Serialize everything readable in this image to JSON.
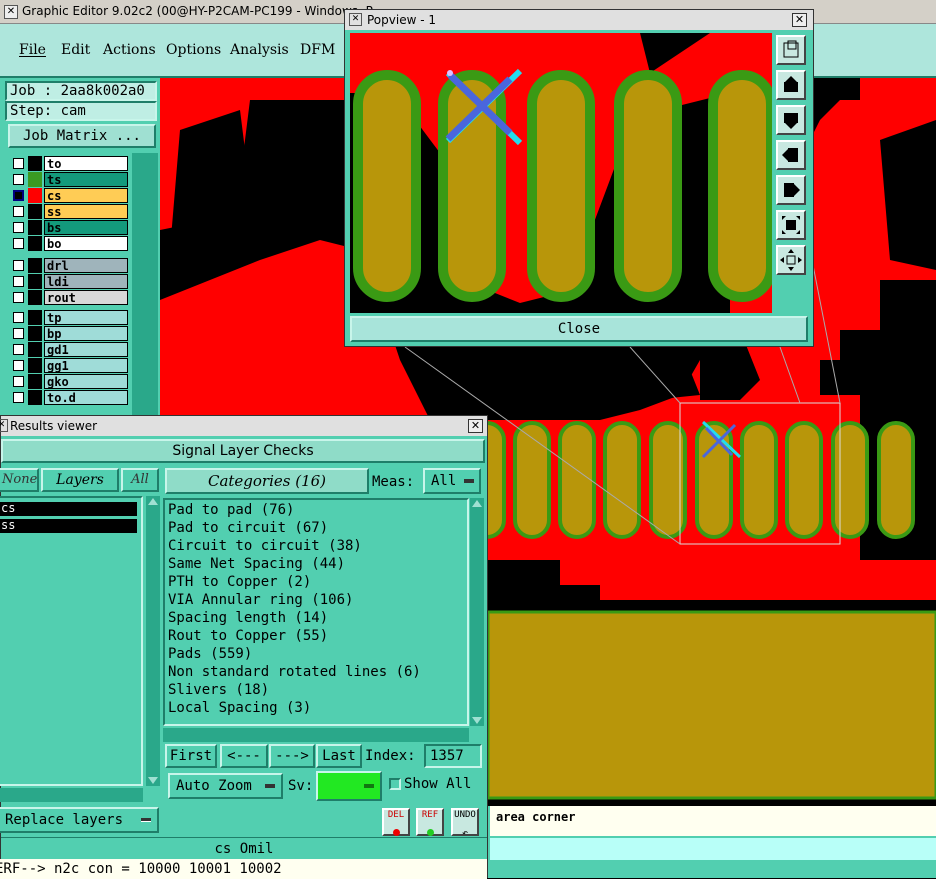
{
  "main_window": {
    "title": "Graphic Editor 9.02c2 (00@HY-P2CAM-PC199 - Windows, P",
    "menu": [
      "File",
      "Edit",
      "Actions",
      "Options",
      "Analysis",
      "DFM"
    ]
  },
  "job_panel": {
    "job": "Job : 2aa8k002a0",
    "step": "Step: cam",
    "matrix_button": "Job Matrix ...",
    "layers_group1": [
      {
        "name": "to",
        "swatch": "#000000",
        "bg": "#ffffff",
        "fg": "#000000"
      },
      {
        "name": "ts",
        "swatch": "#3a9a22",
        "bg": "#139a7c",
        "fg": "#000000"
      },
      {
        "name": "cs",
        "swatch": "#ff0000",
        "bg": "#ffcc55",
        "fg": "#000000"
      },
      {
        "name": "ss",
        "swatch": "#000000",
        "bg": "#ffcc55",
        "fg": "#000000"
      },
      {
        "name": "bs",
        "swatch": "#000000",
        "bg": "#139a7c",
        "fg": "#000000"
      },
      {
        "name": "bo",
        "swatch": "#000000",
        "bg": "#ffffff",
        "fg": "#000000"
      }
    ],
    "layers_group2": [
      {
        "name": "drl",
        "swatch": "#000000",
        "bg": "#9fb4bb",
        "fg": "#000000"
      },
      {
        "name": "ldi",
        "swatch": "#000000",
        "bg": "#9fb4bb",
        "fg": "#000000"
      },
      {
        "name": "rout",
        "swatch": "#000000",
        "bg": "#d8d8d8",
        "fg": "#000000"
      }
    ],
    "layers_group3": [
      {
        "name": "tp",
        "swatch": "#000000",
        "bg": "#9fdcd8",
        "fg": "#000000"
      },
      {
        "name": "bp",
        "swatch": "#000000",
        "bg": "#9fdcd8",
        "fg": "#000000"
      },
      {
        "name": "gd1",
        "swatch": "#000000",
        "bg": "#9fdcd8",
        "fg": "#000000"
      },
      {
        "name": "gg1",
        "swatch": "#000000",
        "bg": "#9fdcd8",
        "fg": "#000000"
      },
      {
        "name": "gko",
        "swatch": "#000000",
        "bg": "#9fdcd8",
        "fg": "#000000"
      },
      {
        "name": "to.d",
        "swatch": "#000000",
        "bg": "#9fdcd8",
        "fg": "#000000"
      }
    ]
  },
  "popview": {
    "title": "Popview - 1",
    "close_label": "Close",
    "tools": [
      "zoom-area-icon",
      "pan-up-icon",
      "pan-down-icon",
      "pan-left-icon",
      "pan-right-icon",
      "zoom-fit-icon",
      "zoom-home-icon"
    ]
  },
  "results_viewer": {
    "title": "Results viewer",
    "header": "Signal Layer Checks",
    "none_label": "None",
    "layers_label": "Layers",
    "all_label": "All",
    "layer_items": [
      "cs",
      "ss"
    ],
    "categories_label": "Categories (16)",
    "meas_label": "Meas:",
    "meas_value": "All",
    "categories": [
      "Pad to pad (76)",
      "Pad to circuit (67)",
      "Circuit to circuit (38)",
      "Same Net Spacing (44)",
      "PTH to Copper (2)",
      "VIA Annular ring (106)",
      "Spacing length (14)",
      "Rout to Copper (55)",
      "Pads (559)",
      "Non standard rotated lines (6)",
      "Slivers (18)",
      "Local Spacing (3)"
    ],
    "first_label": "First",
    "prev_label": "<---",
    "next_label": "--->",
    "last_label": "Last",
    "index_label": "Index:",
    "index_value": "1357",
    "auto_zoom_label": "Auto Zoom",
    "sv_label": "Sv:",
    "show_all_label": "Show All",
    "replace_layers_label": "Replace layers",
    "del_label": "DEL",
    "ref_label": "REF",
    "undo_label": "UNDO",
    "status_layer": "cs Omil",
    "status_line": "ERF--> n2c con = 10000 10001 10002"
  },
  "status_area": {
    "message": "area corner"
  },
  "colors": {
    "copper": "#ff0000",
    "pad": "#b8960a",
    "pad_outline": "#3a9a14",
    "panel": "#52cfb0",
    "marker_blue": "#4a66dd",
    "marker_cyan": "#22ddee"
  }
}
